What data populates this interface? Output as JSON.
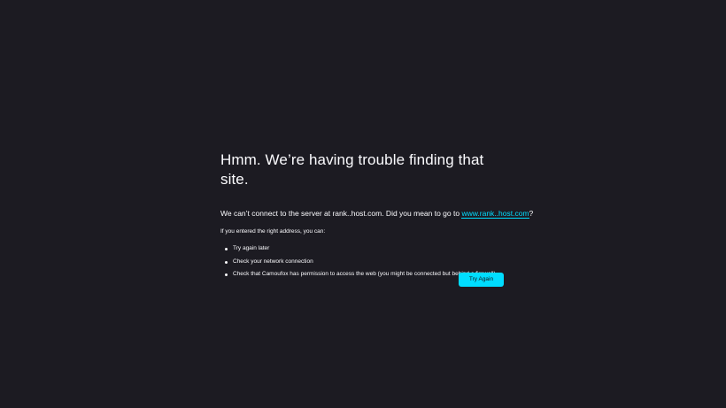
{
  "error_page": {
    "title": "Hmm. We’re having trouble finding that site.",
    "intro_prefix": "We can’t connect to the server at rank..host.com. Did you mean to go to ",
    "suggestion_link": "www.rank..host.com",
    "intro_suffix": "?",
    "hint": "If you entered the right address, you can:",
    "tips": [
      "Try again later",
      "Check your network connection",
      "Check that Camoufox has permission to access the web (you might be connected but behind a firewall)"
    ],
    "try_again_label": "Try Again"
  },
  "colors": {
    "background": "#1c1b22",
    "text": "#fbfbfe",
    "accent": "#00ddff"
  }
}
